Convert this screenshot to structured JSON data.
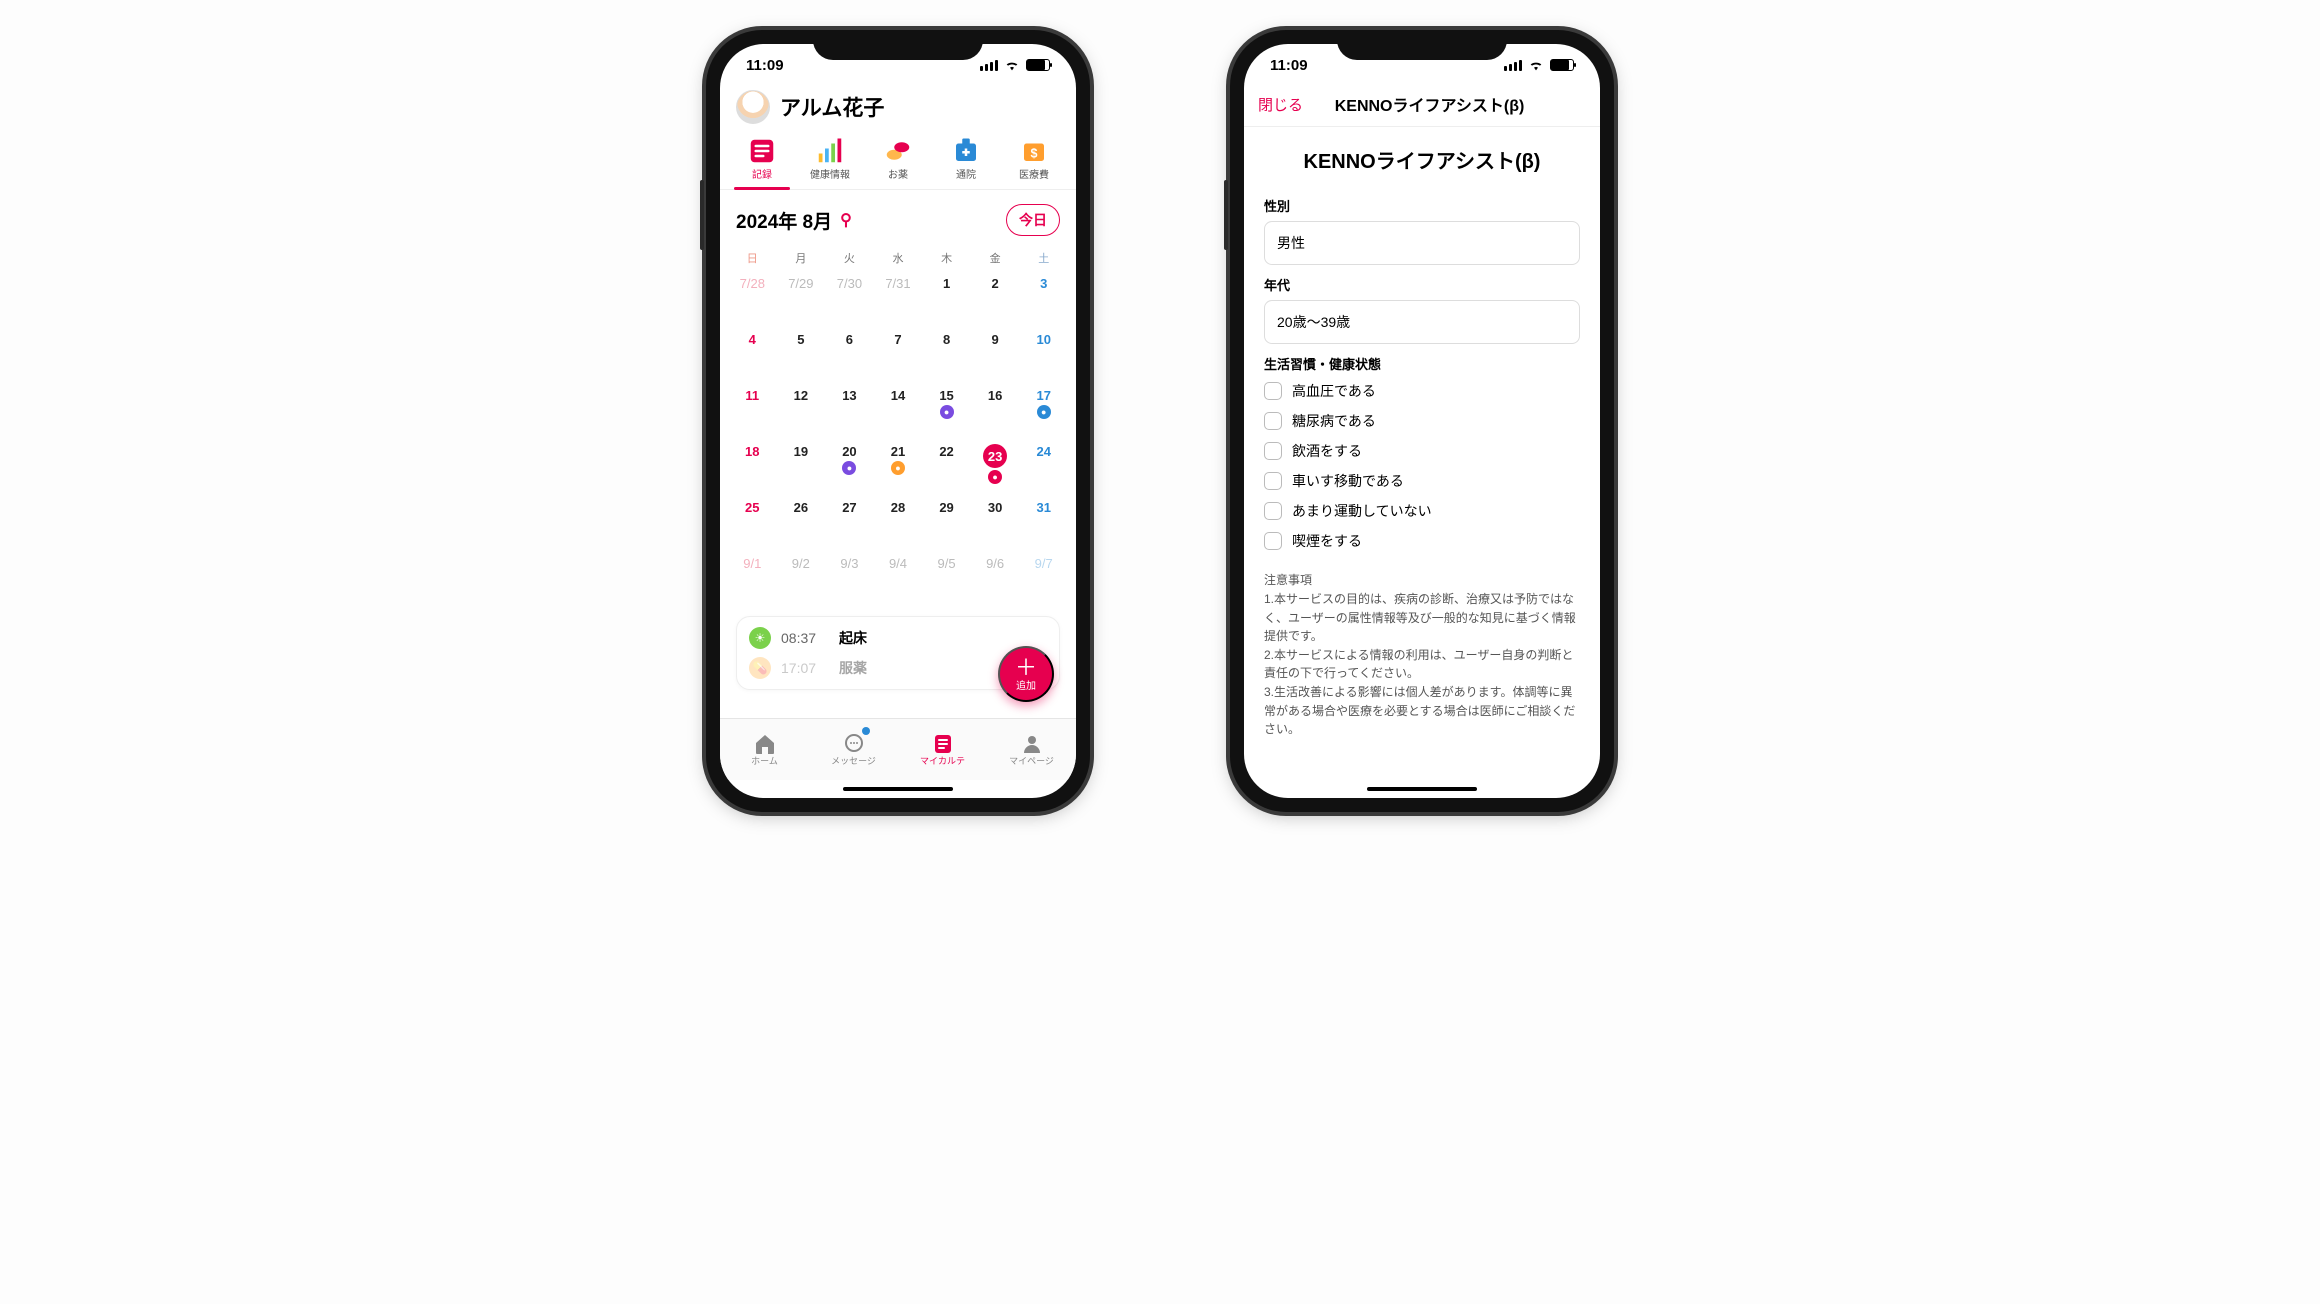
{
  "status": {
    "time": "11:09"
  },
  "left": {
    "profile_name": "アルム花子",
    "categories": [
      {
        "label": "記録",
        "active": true
      },
      {
        "label": "健康情報",
        "active": false
      },
      {
        "label": "お薬",
        "active": false
      },
      {
        "label": "通院",
        "active": false
      },
      {
        "label": "医療費",
        "active": false
      }
    ],
    "month_label": "2024年 8月",
    "today_label": "今日",
    "dow": [
      "日",
      "月",
      "火",
      "水",
      "木",
      "金",
      "土"
    ],
    "calendar": [
      {
        "t": "7/28",
        "cls": "out sun"
      },
      {
        "t": "7/29",
        "cls": "out"
      },
      {
        "t": "7/30",
        "cls": "out"
      },
      {
        "t": "7/31",
        "cls": "out"
      },
      {
        "t": "1"
      },
      {
        "t": "2"
      },
      {
        "t": "3",
        "cls": "sat"
      },
      {
        "t": "4",
        "cls": "sun"
      },
      {
        "t": "5"
      },
      {
        "t": "6"
      },
      {
        "t": "7"
      },
      {
        "t": "8"
      },
      {
        "t": "9"
      },
      {
        "t": "10",
        "cls": "sat"
      },
      {
        "t": "11",
        "cls": "sun"
      },
      {
        "t": "12"
      },
      {
        "t": "13"
      },
      {
        "t": "14"
      },
      {
        "t": "15",
        "marks": [
          "pur"
        ]
      },
      {
        "t": "16"
      },
      {
        "t": "17",
        "cls": "sat",
        "marks": [
          "bl"
        ]
      },
      {
        "t": "18",
        "cls": "sun"
      },
      {
        "t": "19"
      },
      {
        "t": "20",
        "marks": [
          "pur"
        ]
      },
      {
        "t": "21",
        "marks": [
          "or"
        ]
      },
      {
        "t": "22"
      },
      {
        "t": "23",
        "today": true,
        "marks": [
          "rd"
        ]
      },
      {
        "t": "24",
        "cls": "sat"
      },
      {
        "t": "25",
        "cls": "sun"
      },
      {
        "t": "26"
      },
      {
        "t": "27"
      },
      {
        "t": "28"
      },
      {
        "t": "29"
      },
      {
        "t": "30"
      },
      {
        "t": "31",
        "cls": "sat"
      },
      {
        "t": "9/1",
        "cls": "out sun"
      },
      {
        "t": "9/2",
        "cls": "out"
      },
      {
        "t": "9/3",
        "cls": "out"
      },
      {
        "t": "9/4",
        "cls": "out"
      },
      {
        "t": "9/5",
        "cls": "out"
      },
      {
        "t": "9/6",
        "cls": "out"
      },
      {
        "t": "9/7",
        "cls": "out sat"
      }
    ],
    "entries": [
      {
        "time": "08:37",
        "label": "起床",
        "icon": "sun"
      },
      {
        "time": "17:07",
        "label": "服薬",
        "icon": "pill",
        "fade": true
      }
    ],
    "fab_label": "追加",
    "tabs": [
      {
        "label": "ホーム"
      },
      {
        "label": "メッセージ",
        "badge": true
      },
      {
        "label": "マイカルテ",
        "active": true
      },
      {
        "label": "マイページ"
      }
    ]
  },
  "right": {
    "close_label": "閉じる",
    "nav_title": "KENNOライフアシスト(β)",
    "title": "KENNOライフアシスト(β)",
    "gender_label": "性別",
    "gender_value": "男性",
    "age_label": "年代",
    "age_value": "20歳〜39歳",
    "section_label": "生活習慣・健康状態",
    "checks": [
      "高血圧である",
      "糖尿病である",
      "飲酒をする",
      "車いす移動である",
      "あまり運動していない",
      "喫煙をする"
    ],
    "notes_heading": "注意事項",
    "notes": [
      "1.本サービスの目的は、疾病の診断、治療又は予防ではなく、ユーザーの属性情報等及び一般的な知見に基づく情報提供です。",
      "2.本サービスによる情報の利用は、ユーザー自身の判断と責任の下で行ってください。",
      "3.生活改善による影響には個人差があります。体調等に異常がある場合や医療を必要とする場合は医師にご相談ください。"
    ]
  }
}
